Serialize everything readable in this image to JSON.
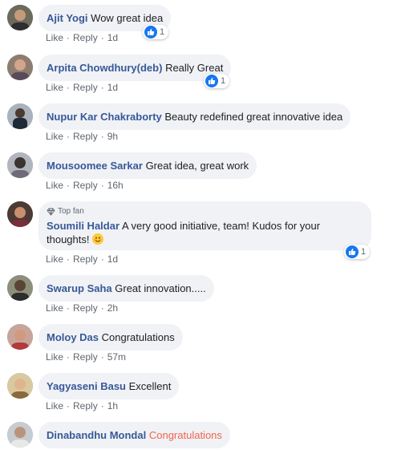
{
  "comments": [
    {
      "name": "Ajit Yogi",
      "text": "Wow great idea",
      "like": "Like",
      "reply": "Reply",
      "time": "1d",
      "reactions": "1"
    },
    {
      "name": "Arpita Chowdhury(deb)",
      "text": "Really Great",
      "like": "Like",
      "reply": "Reply",
      "time": "1d",
      "reactions": "1"
    },
    {
      "name": "Nupur Kar Chakraborty",
      "text": "Beauty redefined great innovative idea",
      "like": "Like",
      "reply": "Reply",
      "time": "9h"
    },
    {
      "name": "Mousoomee Sarkar",
      "text": "Great idea, great work",
      "like": "Like",
      "reply": "Reply",
      "time": "16h"
    },
    {
      "badge": "Top fan",
      "name": "Soumili Haldar",
      "text": "A very good initiative, team! Kudos for your thoughts!",
      "emoji": "smiling-face-emoji",
      "like": "Like",
      "reply": "Reply",
      "time": "1d",
      "reactions": "1"
    },
    {
      "name": "Swarup Saha",
      "text": "Great innovation.....",
      "like": "Like",
      "reply": "Reply",
      "time": "2h"
    },
    {
      "name": "Moloy Das",
      "text": "Congratulations",
      "like": "Like",
      "reply": "Reply",
      "time": "57m"
    },
    {
      "name": "Yagyaseni Basu",
      "text": "Excellent",
      "like": "Like",
      "reply": "Reply",
      "time": "1h"
    },
    {
      "name": "Dinabandhu Mondal",
      "text": "Congratulations",
      "text_color": "#f0654f"
    }
  ],
  "colors": {
    "name": "#385898",
    "bubble": "#f0f2f5",
    "like_reaction": "#1877f2",
    "meta": "#606770"
  }
}
